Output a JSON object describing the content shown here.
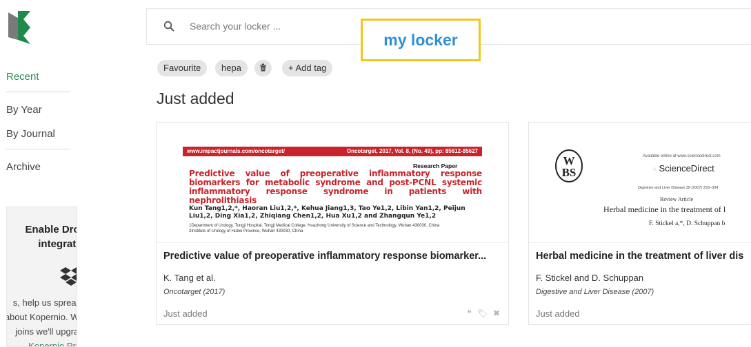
{
  "sidebar": {
    "nav": {
      "recent": "Recent",
      "by_year": "By Year",
      "by_journal": "By Journal",
      "archive": "Archive"
    },
    "dropbox": {
      "title": "Enable Dropbox integration",
      "text_before_link": "s, help us spread the word about Kopernio. When a friend joins we'll upgrade you to ",
      "link": "Kopernio Premium"
    }
  },
  "search": {
    "placeholder": "Search your locker ..."
  },
  "locker_badge": "my locker",
  "tags": [
    "Favourite",
    "hepa",
    "+ Add tag"
  ],
  "section_title": "Just added",
  "cards": [
    {
      "title": "Predictive value of preoperative inflammatory response biomarker...",
      "authors": "K. Tang et al.",
      "journal": "Oncotarget (2017)",
      "status": "Just added",
      "thumb": {
        "header_left": "www.impactjournals.com/oncotarget/",
        "header_right": "Oncotarget, 2017, Vol. 8, (No. 49), pp: 85612-85627",
        "type": "Research Paper",
        "title": "Predictive value of preoperative inflammatory response biomarkers for metabolic syndrome and post-PCNL systemic inflammatory response syndrome in patients with nephrolithiasis",
        "authors": "Kun Tang1,2,*, Haoran Liu1,2,*, Kehua Jiang1,3, Tao Ye1,2, Libin Yan1,2, Peijun Liu1,2, Ding Xia1,2, Zhiqiang Chen1,2, Hua Xu1,2 and Zhangqun Ye1,2",
        "affiliation": "1Department of Urology, Tongji Hospital, Tongji Medical College, Huazhong University of Science and Technology, Wuhan 430030, China",
        "affiliation2": "2Institute of Urology of Hubei Province, Wuhan 430030, China"
      }
    },
    {
      "title": "Herbal medicine in the treatment of liver dis",
      "authors": "F. Stickel and D. Schuppan",
      "journal": "Digestive and Liver Disease (2007)",
      "status": "Just added",
      "thumb": {
        "avail": "Available online at www.sciencedirect.com",
        "publisher": "ScienceDirect",
        "meta": "Digestive and Liver Disease 39 (2007) 293–304",
        "type": "Review Article",
        "heading": "Herbal medicine in the treatment of l",
        "authors": "F. Stickel a,*, D. Schuppan b"
      }
    }
  ],
  "colors": {
    "accent_green": "#2e8b57",
    "locker_border": "#f5c518",
    "locker_text": "#2f8fd6",
    "paper_red": "#c9242b"
  }
}
